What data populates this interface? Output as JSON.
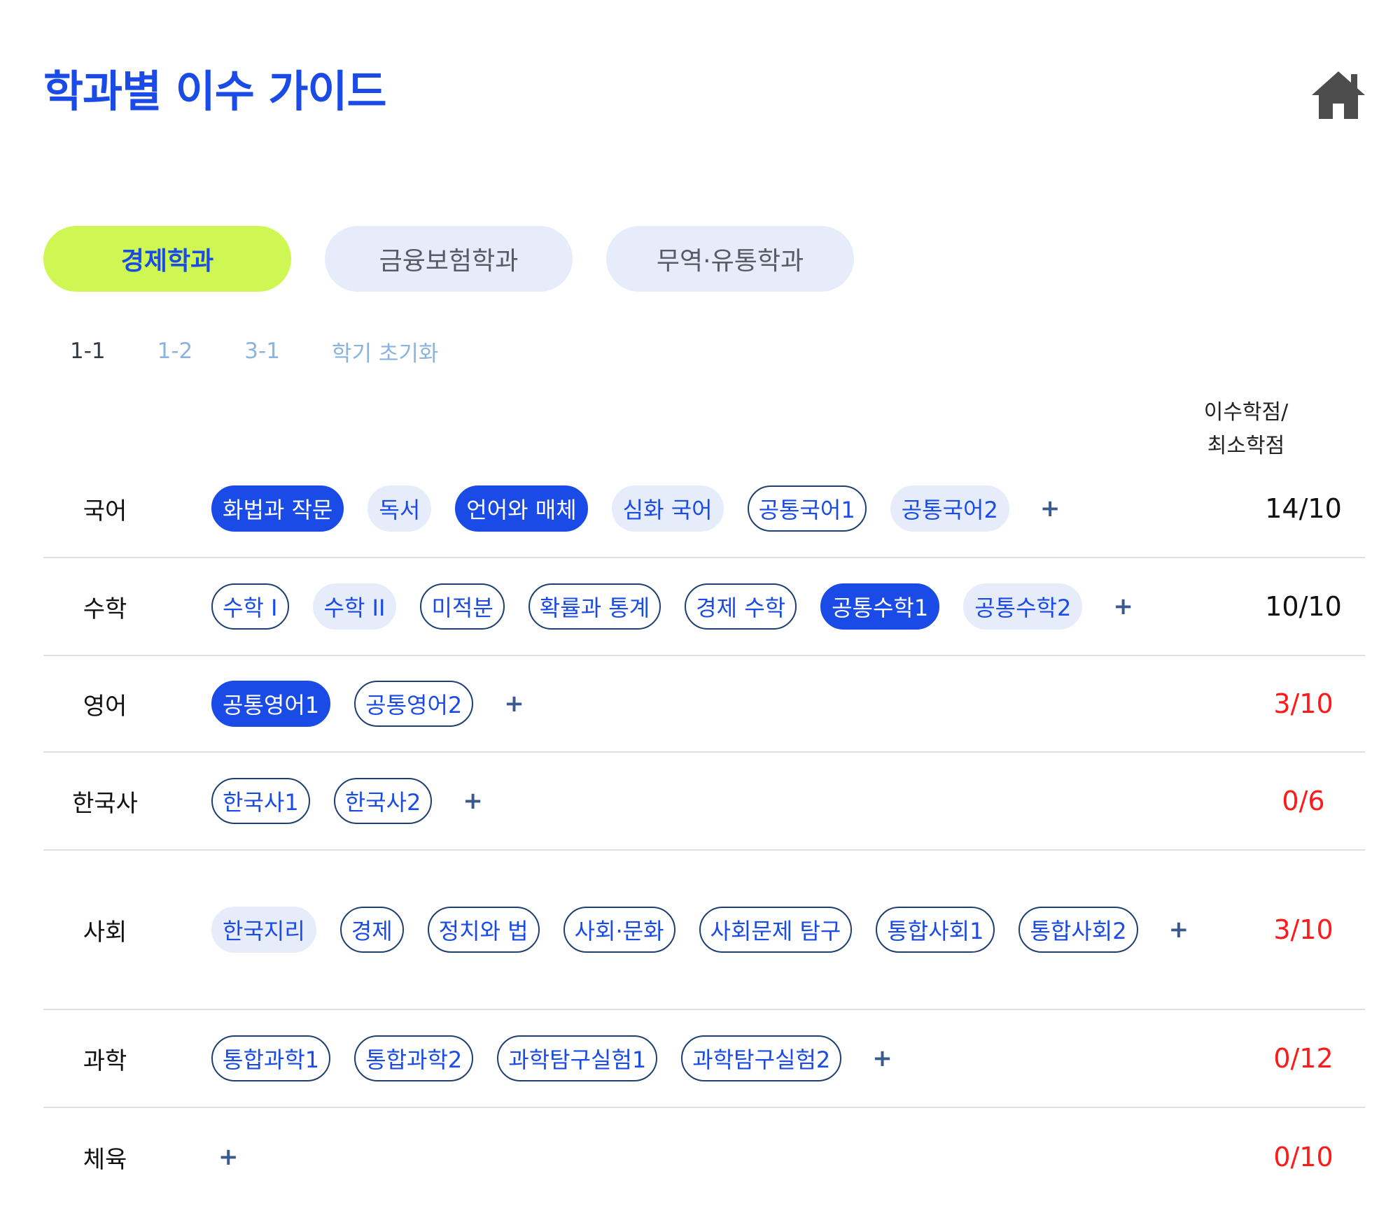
{
  "title": "학과별 이수 가이드",
  "home_icon": "home-icon",
  "departments": [
    {
      "label": "경제학과",
      "active": true
    },
    {
      "label": "금융보험학과",
      "active": false
    },
    {
      "label": "무역·유통학과",
      "active": false
    }
  ],
  "semesters": [
    {
      "label": "1-1",
      "active": true
    },
    {
      "label": "1-2",
      "active": false
    },
    {
      "label": "3-1",
      "active": false
    },
    {
      "label": "학기 초기화",
      "active": false
    }
  ],
  "credit_header": {
    "line1": "이수학점/",
    "line2": "최소학점"
  },
  "plus_label": "+",
  "colors": {
    "accent": "#1a4be6",
    "active_tab": "#cff753",
    "warning": "#ff1a1a"
  },
  "rows": [
    {
      "subject": "국어",
      "credit": "14/10",
      "met": true,
      "courses": [
        {
          "label": "화법과 작문",
          "state": "done"
        },
        {
          "label": "독서",
          "state": "soft"
        },
        {
          "label": "언어와 매체",
          "state": "done"
        },
        {
          "label": "심화 국어",
          "state": "soft"
        },
        {
          "label": "공통국어1",
          "state": "outline"
        },
        {
          "label": "공통국어2",
          "state": "soft"
        }
      ]
    },
    {
      "subject": "수학",
      "credit": "10/10",
      "met": true,
      "courses": [
        {
          "label": "수학 I",
          "state": "outline"
        },
        {
          "label": "수학 II",
          "state": "soft"
        },
        {
          "label": "미적분",
          "state": "outline"
        },
        {
          "label": "확률과 통계",
          "state": "outline"
        },
        {
          "label": "경제 수학",
          "state": "outline"
        },
        {
          "label": "공통수학1",
          "state": "done"
        },
        {
          "label": "공통수학2",
          "state": "soft"
        }
      ]
    },
    {
      "subject": "영어",
      "credit": "3/10",
      "met": false,
      "courses": [
        {
          "label": "공통영어1",
          "state": "done"
        },
        {
          "label": "공통영어2",
          "state": "outline"
        }
      ]
    },
    {
      "subject": "한국사",
      "credit": "0/6",
      "met": false,
      "courses": [
        {
          "label": "한국사1",
          "state": "outline"
        },
        {
          "label": "한국사2",
          "state": "outline"
        }
      ]
    },
    {
      "subject": "사회",
      "credit": "3/10",
      "met": false,
      "courses": [
        {
          "label": "한국지리",
          "state": "soft"
        },
        {
          "label": "경제",
          "state": "outline"
        },
        {
          "label": "정치와 법",
          "state": "outline"
        },
        {
          "label": "사회·문화",
          "state": "outline"
        },
        {
          "label": "사회문제 탐구",
          "state": "outline"
        },
        {
          "label": "통합사회1",
          "state": "outline"
        },
        {
          "label": "통합사회2",
          "state": "outline"
        }
      ]
    },
    {
      "subject": "과학",
      "credit": "0/12",
      "met": false,
      "courses": [
        {
          "label": "통합과학1",
          "state": "outline"
        },
        {
          "label": "통합과학2",
          "state": "outline"
        },
        {
          "label": "과학탐구실험1",
          "state": "outline"
        },
        {
          "label": "과학탐구실험2",
          "state": "outline"
        }
      ]
    },
    {
      "subject": "체육",
      "credit": "0/10",
      "met": false,
      "courses": []
    }
  ]
}
